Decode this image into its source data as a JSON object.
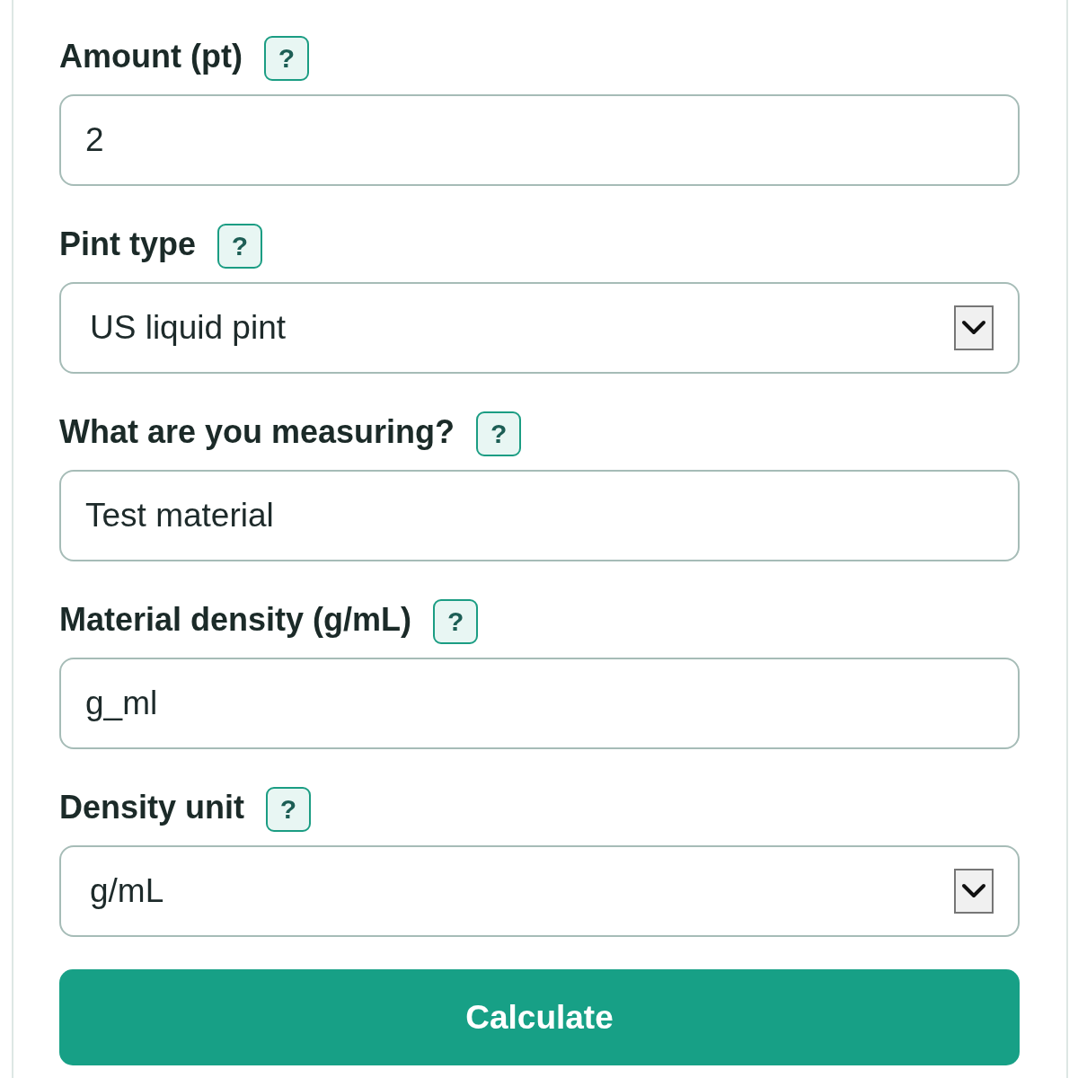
{
  "fields": [
    {
      "kind": "input",
      "label": "Amount (pt)",
      "help": "?",
      "value": "2"
    },
    {
      "kind": "select",
      "label": "Pint type",
      "help": "?",
      "value": "US liquid pint"
    },
    {
      "kind": "input",
      "label": "What are you measuring?",
      "help": "?",
      "value": "Test material"
    },
    {
      "kind": "input",
      "label": "Material density (g/mL)",
      "help": "?",
      "value": "g_ml"
    },
    {
      "kind": "select",
      "label": "Density unit",
      "help": "?",
      "value": "g/mL"
    }
  ],
  "submit": {
    "label": "Calculate"
  }
}
